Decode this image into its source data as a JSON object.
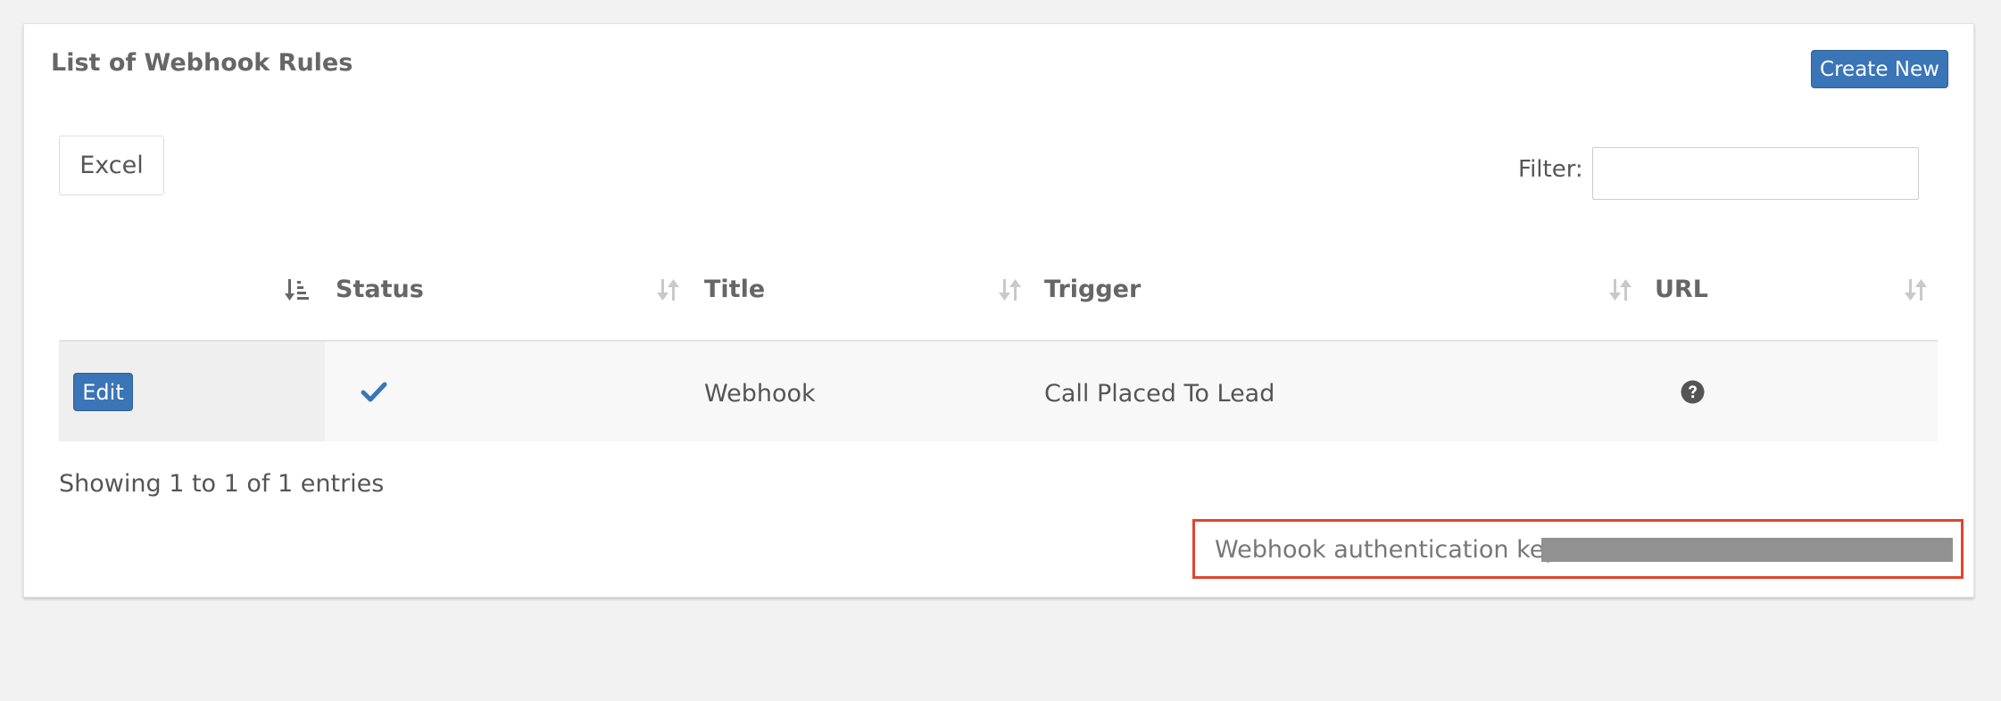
{
  "panel": {
    "title": "List of Webhook Rules",
    "create_label": "Create New"
  },
  "toolbar": {
    "excel_label": "Excel",
    "filter_label": "Filter:",
    "filter_value": ""
  },
  "table": {
    "columns": [
      {
        "label": "",
        "sort": "sort-asc-icon"
      },
      {
        "label": "Status",
        "sort": "sort-both-icon"
      },
      {
        "label": "Title",
        "sort": "sort-both-icon"
      },
      {
        "label": "Trigger",
        "sort": "sort-both-icon"
      },
      {
        "label": "URL",
        "sort": "sort-both-icon"
      }
    ],
    "rows": [
      {
        "edit_label": "Edit",
        "status_icon": "checkmark-icon",
        "title": "Webhook",
        "trigger": "Call Placed To Lead",
        "url_icon": "question-circle-icon"
      }
    ]
  },
  "info": "Showing 1 to 1 of 1 entries",
  "auth": {
    "label": "Webhook authentication key:",
    "value_redacted": true
  },
  "colors": {
    "accent": "#3a75b8",
    "highlight_border": "#e2442f",
    "redaction": "#919191"
  }
}
